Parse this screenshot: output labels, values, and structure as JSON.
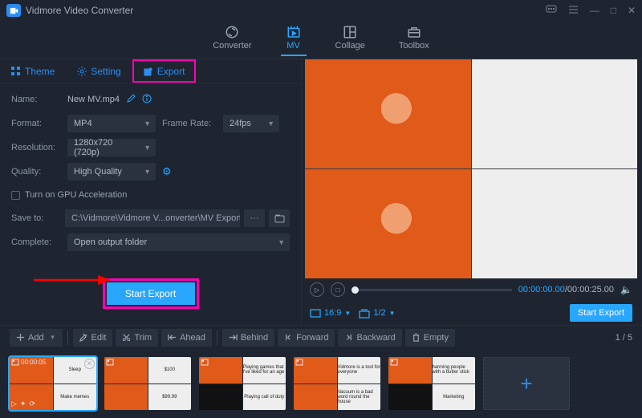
{
  "app": {
    "title": "Vidmore Video Converter"
  },
  "topnav": {
    "converter": "Converter",
    "mv": "MV",
    "collage": "Collage",
    "toolbox": "Toolbox"
  },
  "tabs": {
    "theme": "Theme",
    "setting": "Setting",
    "export": "Export"
  },
  "form": {
    "name_label": "Name:",
    "name_value": "New MV.mp4",
    "format_label": "Format:",
    "format_value": "MP4",
    "framerate_label": "Frame Rate:",
    "framerate_value": "24fps",
    "resolution_label": "Resolution:",
    "resolution_value": "1280x720 (720p)",
    "quality_label": "Quality:",
    "quality_value": "High Quality",
    "gpu_label": "Turn on GPU Acceleration",
    "saveto_label": "Save to:",
    "saveto_value": "C:\\Vidmore\\Vidmore V...onverter\\MV Exported",
    "browse_more": "···",
    "complete_label": "Complete:",
    "complete_value": "Open output folder",
    "start_export": "Start Export"
  },
  "player": {
    "time_current": "00:00:00.00",
    "time_total": "00:00:25.00",
    "ratio": "16:9",
    "page": "1/2"
  },
  "right": {
    "start_export": "Start Export"
  },
  "toolbar": {
    "add": "Add",
    "edit": "Edit",
    "trim": "Trim",
    "ahead": "Ahead",
    "behind": "Behind",
    "forward": "Forward",
    "backward": "Backward",
    "empty": "Empty",
    "pager": "1 / 5"
  },
  "timeline": {
    "item1": {
      "timecode": "00:00:05",
      "c1": "Sleep",
      "c2": "Make memes"
    },
    "item2": {
      "c1": "$100",
      "c2": "$99.99"
    },
    "item3": {
      "c1": "Playing games that I've liked for an age",
      "c2": "Playing call of duty"
    },
    "item4": {
      "c1": "Vidmore is a tool for everyone",
      "c2": "Vacuum is a bad word round the house"
    },
    "item5": {
      "c1": "harming people with a butter stick",
      "c2": "Marketing"
    }
  }
}
